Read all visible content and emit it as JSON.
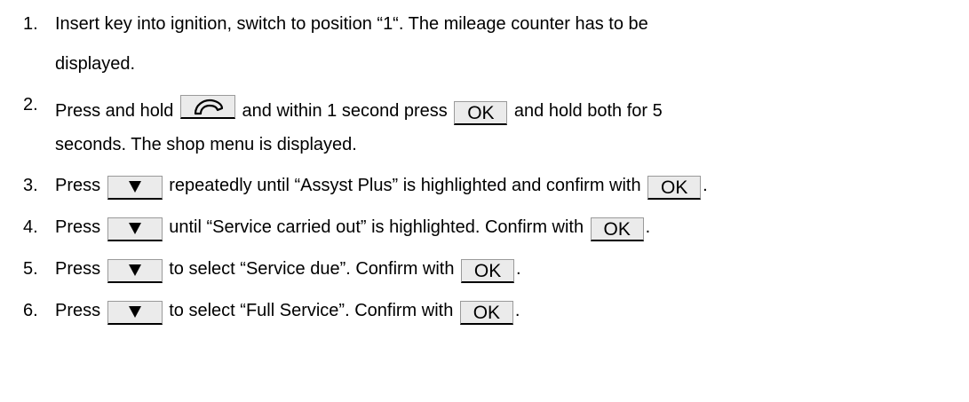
{
  "steps": [
    {
      "number": "1.",
      "line1": "Insert key into ignition, switch to position “1“. The mileage counter has to be",
      "line2": "displayed."
    },
    {
      "number": "2.",
      "line1_a": "Press and hold",
      "line1_b": "and within 1 second press",
      "line1_c": "and hold both for 5",
      "line2": "seconds. The shop menu is displayed."
    },
    {
      "number": "3.",
      "a": "Press",
      "b": "repeatedly until “Assyst Plus” is highlighted and confirm with",
      "c": "."
    },
    {
      "number": "4.",
      "a": "Press",
      "b": "until “Service carried out” is highlighted. Confirm with",
      "c": "."
    },
    {
      "number": "5.",
      "a": "Press",
      "b": "to select “Service due”. Confirm with",
      "c": "."
    },
    {
      "number": "6.",
      "a": "Press",
      "b": "to select “Full Service”. Confirm with",
      "c": "."
    }
  ],
  "keys": {
    "ok_label": "OK",
    "down_icon": "down-arrow-icon",
    "phone_icon": "phone-handset-icon"
  }
}
